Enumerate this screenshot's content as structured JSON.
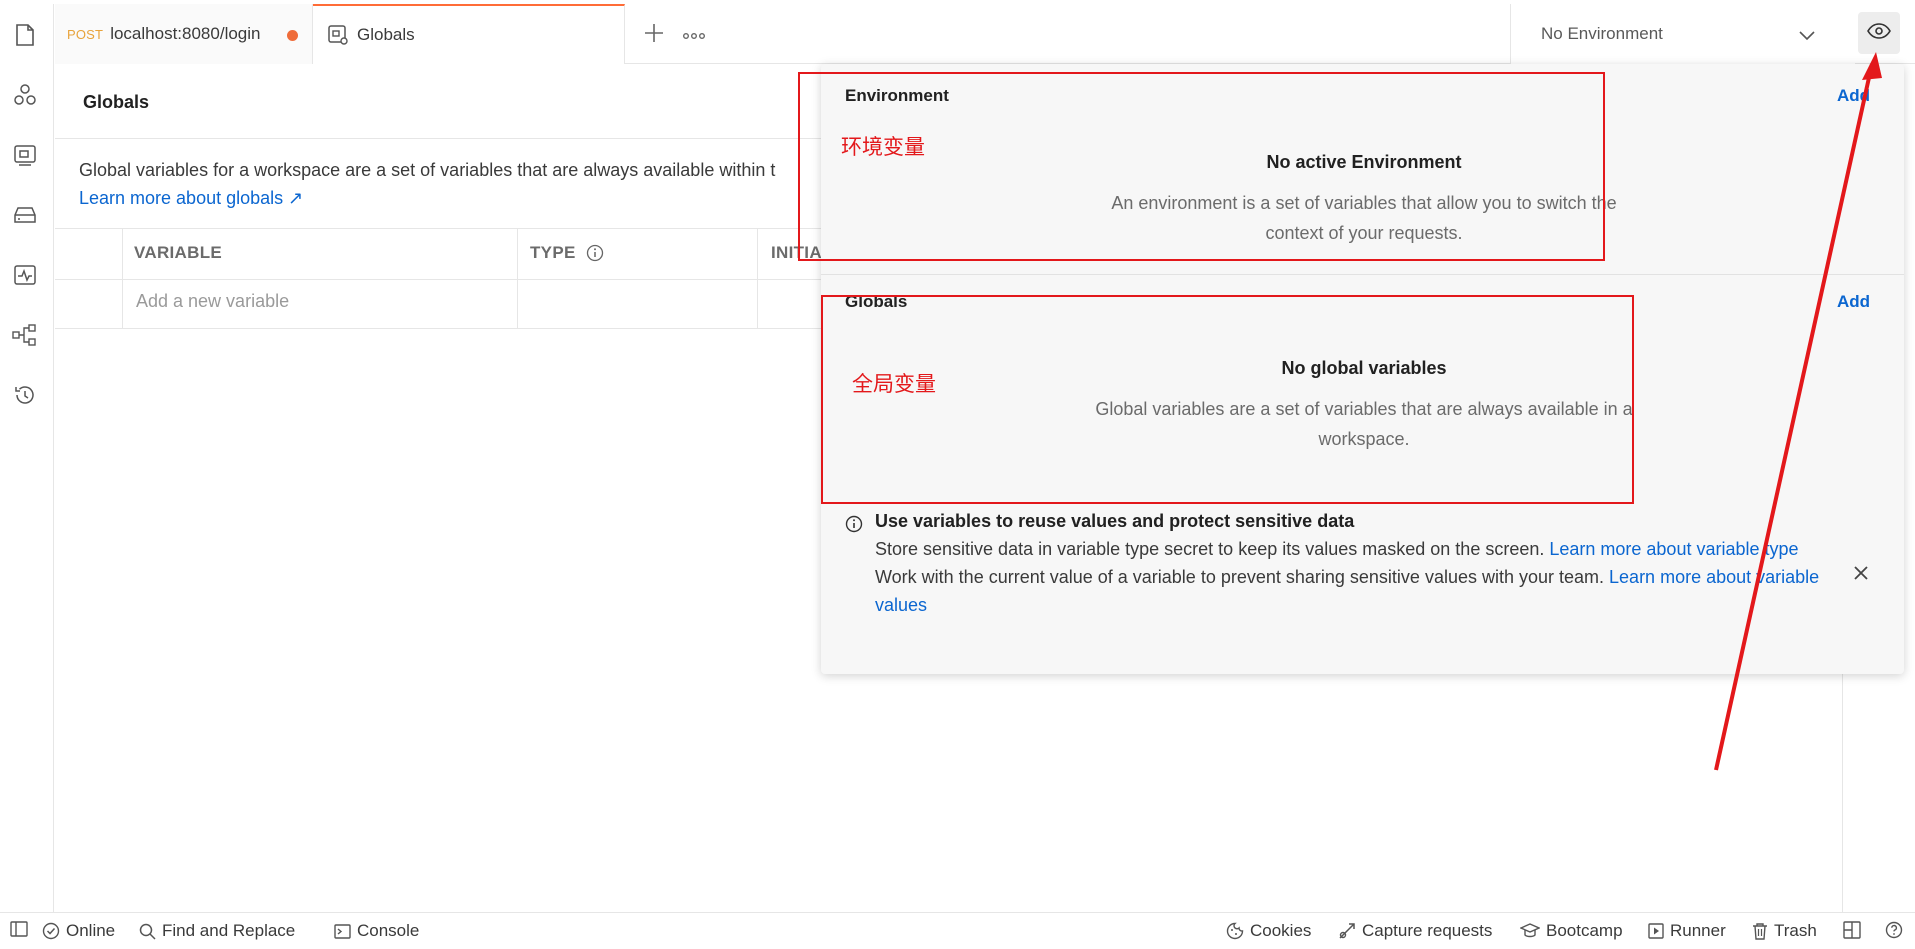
{
  "tabs": {
    "request": {
      "method": "POST",
      "label": "localhost:8080/login"
    },
    "globals": {
      "label": "Globals"
    }
  },
  "environment_selector": {
    "value": "No Environment"
  },
  "globals_page": {
    "title": "Globals",
    "description": "Global variables for a workspace are a set of variables that are always available within t",
    "learn_more": "Learn more about globals ↗",
    "table": {
      "columns": [
        "VARIABLE",
        "TYPE",
        "INITIA"
      ],
      "add_placeholder": "Add a new variable"
    }
  },
  "quick_look": {
    "environment": {
      "title": "Environment",
      "add_label": "Add",
      "empty_title": "No active Environment",
      "empty_desc_line1": "An environment is a set of variables that allow you to switch the",
      "empty_desc_line2": "context of your requests."
    },
    "globals": {
      "title": "Globals",
      "add_label": "Add",
      "empty_title": "No global variables",
      "empty_desc_line1": "Global variables are a set of variables that are always available in a",
      "empty_desc_line2": "workspace."
    },
    "info": {
      "heading": "Use variables to reuse values and protect sensitive data",
      "line1": "Store sensitive data in variable type secret to keep its values masked on the screen. ",
      "link1": "Learn more about variable type",
      "line2": "Work with the current value of a variable to prevent sharing sensitive values with your team. ",
      "link2": "Learn more about variable values"
    }
  },
  "annotations": {
    "env_label": "环境变量",
    "globals_label": "全局变量",
    "color": "#e3181b"
  },
  "statusbar": {
    "online": "Online",
    "find_replace": "Find and Replace",
    "console": "Console",
    "cookies": "Cookies",
    "capture": "Capture requests",
    "bootcamp": "Bootcamp",
    "runner": "Runner",
    "trash": "Trash"
  },
  "colors": {
    "accent": "#ff6c37",
    "link": "#0b66d0",
    "method_post": "#e8a33a",
    "unsaved_dot": "#ef6c3a"
  }
}
